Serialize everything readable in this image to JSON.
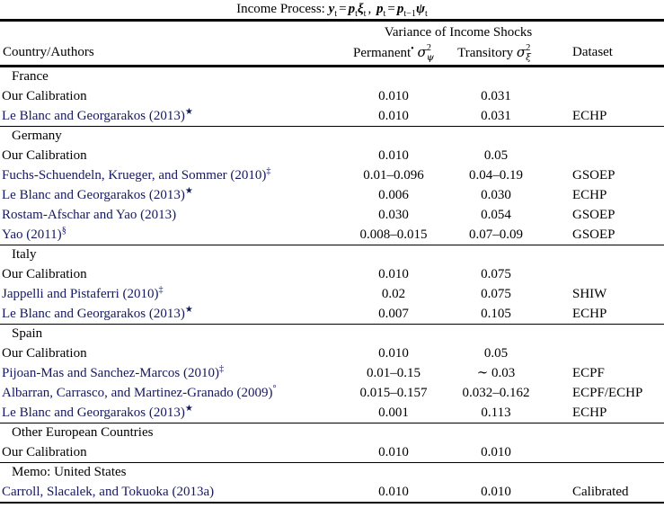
{
  "caption": {
    "prefix": "Income Process:",
    "eq1_lhs": "y",
    "eq1_lhs_sub": "t",
    "eq1_rhs_p": "p",
    "eq1_rhs_p_sub": "t",
    "eq1_rhs_xi": "ξ",
    "eq1_rhs_xi_sub": "t",
    "eq2_lhs": "p",
    "eq2_lhs_sub": "t",
    "eq2_rhs_p": "p",
    "eq2_rhs_p_sub": "t−1",
    "eq2_rhs_psi": "ψ",
    "eq2_rhs_psi_sub": "t",
    "full_text": "Income Process: y_t = p_t ξ_t, p_t = p_{t−1}ψ_t"
  },
  "header": {
    "group_label": "Variance of Income Shocks",
    "col_country": "Country/Authors",
    "col_permanent_label": "Permanent",
    "col_permanent_marker": "•",
    "col_permanent_symbol": "σ",
    "col_permanent_sup": "2",
    "col_permanent_sub": "ψ",
    "col_transitory_label": "Transitory",
    "col_transitory_symbol": "σ",
    "col_transitory_sup": "2",
    "col_transitory_sub": "ξ",
    "col_dataset": "Dataset"
  },
  "colors": {
    "link": "#16185e",
    "text": "#000000",
    "rule": "#000000",
    "background": "#ffffff"
  },
  "sections": [
    {
      "title": "France",
      "rows": [
        {
          "author": "Our Calibration",
          "author_sup": "",
          "is_link": false,
          "permanent": "0.010",
          "transitory": "0.031",
          "dataset": ""
        },
        {
          "author": "Le Blanc and Georgarakos (2013)",
          "author_sup": "★",
          "is_link": true,
          "permanent": "0.010",
          "transitory": "0.031",
          "dataset": "ECHP"
        }
      ]
    },
    {
      "title": "Germany",
      "rows": [
        {
          "author": "Our Calibration",
          "author_sup": "",
          "is_link": false,
          "permanent": "0.010",
          "transitory": "0.05",
          "dataset": ""
        },
        {
          "author": "Fuchs-Schuendeln, Krueger, and Sommer (2010)",
          "author_sup": "‡",
          "is_link": true,
          "permanent": "0.01–0.096",
          "transitory": "0.04–0.19",
          "dataset": "GSOEP"
        },
        {
          "author": "Le Blanc and Georgarakos (2013)",
          "author_sup": "★",
          "is_link": true,
          "permanent": "0.006",
          "transitory": "0.030",
          "dataset": "ECHP"
        },
        {
          "author": "Rostam-Afschar and Yao (2013)",
          "author_sup": "",
          "is_link": true,
          "permanent": "0.030",
          "transitory": "0.054",
          "dataset": "GSOEP"
        },
        {
          "author": "Yao (2011)",
          "author_sup": "§",
          "is_link": true,
          "permanent": "0.008–0.015",
          "transitory": "0.07–0.09",
          "dataset": "GSOEP"
        }
      ]
    },
    {
      "title": "Italy",
      "rows": [
        {
          "author": "Our Calibration",
          "author_sup": "",
          "is_link": false,
          "permanent": "0.010",
          "transitory": "0.075",
          "dataset": ""
        },
        {
          "author": "Jappelli and Pistaferri (2010)",
          "author_sup": "‡",
          "is_link": true,
          "permanent": "0.02",
          "transitory": "0.075",
          "dataset": "SHIW"
        },
        {
          "author": "Le Blanc and Georgarakos (2013)",
          "author_sup": "★",
          "is_link": true,
          "permanent": "0.007",
          "transitory": "0.105",
          "dataset": "ECHP"
        }
      ]
    },
    {
      "title": "Spain",
      "rows": [
        {
          "author": "Our Calibration",
          "author_sup": "",
          "is_link": false,
          "permanent": "0.010",
          "transitory": "0.05",
          "dataset": ""
        },
        {
          "author": "Pijoan-Mas and Sanchez-Marcos (2010)",
          "author_sup": "‡",
          "is_link": true,
          "permanent": "0.01–0.15",
          "transitory": "∼ 0.03",
          "dataset": "ECPF"
        },
        {
          "author": "Albarran, Carrasco, and Martinez-Granado (2009)",
          "author_sup": "°",
          "is_link": true,
          "permanent": "0.015–0.157",
          "transitory": "0.032–0.162",
          "dataset": "ECPF/ECHP"
        },
        {
          "author": "Le Blanc and Georgarakos (2013)",
          "author_sup": "★",
          "is_link": true,
          "permanent": "0.001",
          "transitory": "0.113",
          "dataset": "ECHP"
        }
      ]
    },
    {
      "title": "Other European Countries",
      "rows": [
        {
          "author": "Our Calibration",
          "author_sup": "",
          "is_link": false,
          "permanent": "0.010",
          "transitory": "0.010",
          "dataset": ""
        }
      ]
    },
    {
      "title": "Memo: United States",
      "rows": [
        {
          "author": "Carroll, Slacalek, and Tokuoka (2013a)",
          "author_sup": "",
          "is_link": true,
          "permanent": "0.010",
          "transitory": "0.010",
          "dataset": "Calibrated"
        }
      ]
    }
  ]
}
